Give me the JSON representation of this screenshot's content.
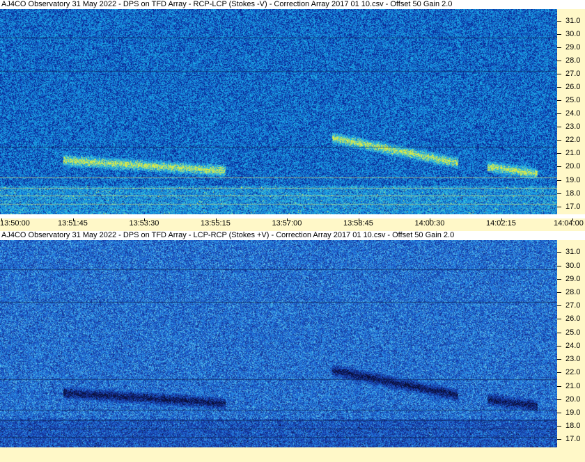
{
  "panels": [
    {
      "title": "AJ4CO Observatory 31 May 2022  -  DPS on TFD Array  -  RCP-LCP (Stokes -V)  -  Correction Array 2017 01 10.csv  -  Offset 50  Gain 2.0",
      "polarity": "bright",
      "colors": {
        "base": "#1b58c8",
        "signal": "#e8f040"
      }
    },
    {
      "title": "AJ4CO Observatory 31 May 2022  -  DPS on TFD Array  -  LCP-RCP (Stokes +V)  -  Correction Array 2017 01 10.csv  -  Offset 50  Gain 2.0",
      "polarity": "dark",
      "colors": {
        "base": "#1b58c8",
        "signal": "#0a1030"
      }
    }
  ],
  "chart_data": {
    "type": "heatmap",
    "ylabel": "",
    "xlabel": "",
    "y_ticks": [
      "31.0",
      "30.0",
      "29.0",
      "28.0",
      "27.0",
      "26.0",
      "25.0",
      "24.0",
      "23.0",
      "22.0",
      "21.0",
      "20.0",
      "19.0",
      "18.0",
      "17.0"
    ],
    "ylim": [
      16.4,
      31.9
    ],
    "x_ticks": [
      "13:50:00",
      "13:51:45",
      "13:53:30",
      "13:55:15",
      "13:57:00",
      "13:58:45",
      "14:00:30",
      "14:02:15",
      "14:04:00"
    ],
    "xlim": [
      "13:50:00",
      "14:04:00"
    ],
    "features": [
      {
        "start": "13:51:35",
        "end": "13:55:40",
        "f_start": 20.5,
        "f_end": 19.7
      },
      {
        "start": "13:58:20",
        "end": "14:01:30",
        "f_start": 22.2,
        "f_end": 20.3
      },
      {
        "start": "14:02:15",
        "end": "14:03:30",
        "f_start": 20.0,
        "f_end": 19.5
      }
    ]
  }
}
